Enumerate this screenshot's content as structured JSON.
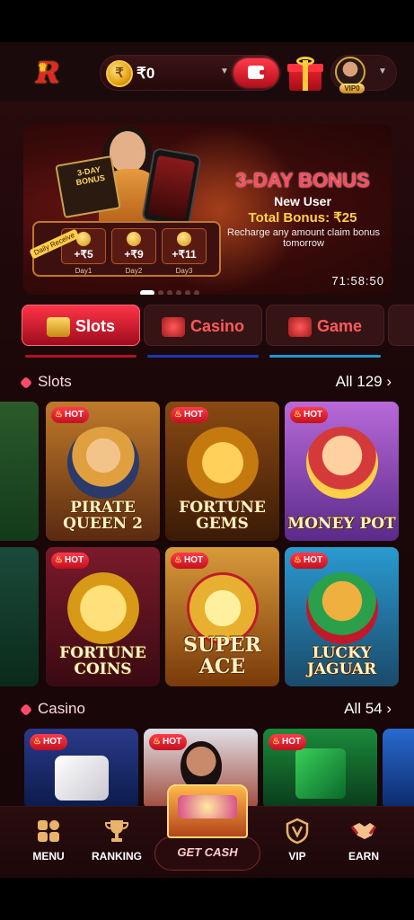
{
  "header": {
    "coin_symbol": "₹",
    "balance": "₹0",
    "vip_badge": "VIP0"
  },
  "banner": {
    "suitcase_text": "3-DAY BONUS",
    "receive_tag": "Daily Receive",
    "days": [
      {
        "amount": "+₹5",
        "label": "Day1"
      },
      {
        "amount": "+₹9",
        "label": "Day2"
      },
      {
        "amount": "+₹11",
        "label": "Day3"
      }
    ],
    "title": "3-DAY BONUS",
    "subtitle": "New User",
    "total": "Total Bonus: ₹25",
    "note": "Recharge any amount claim bonus tomorrow",
    "countdown": "71:58:50"
  },
  "tabs": [
    {
      "label": "Slots",
      "active": true
    },
    {
      "label": "Casino",
      "active": false
    },
    {
      "label": "Game",
      "active": false
    }
  ],
  "slots": {
    "title": "Slots",
    "all": "All 129 ›",
    "games": [
      {
        "name": "PIRATE QUEEN 2",
        "hot": "HOT"
      },
      {
        "name": "FORTUNE GEMS",
        "hot": "HOT"
      },
      {
        "name": "MONEY POT",
        "hot": "HOT"
      },
      {
        "name": "FORTUNE COINS",
        "hot": "HOT"
      },
      {
        "name": "SUPER ACE",
        "hot": "HOT"
      },
      {
        "name": "LUCKY JAGUAR",
        "hot": "HOT"
      }
    ]
  },
  "casino": {
    "title": "Casino",
    "all": "All 54 ›",
    "games": [
      {
        "hot": "HOT"
      },
      {
        "hot": "HOT"
      },
      {
        "hot": "HOT"
      }
    ]
  },
  "nav": {
    "menu": "MENU",
    "ranking": "RANKING",
    "get_cash": "GET CASH",
    "vip": "VIP",
    "earn": "EARN"
  },
  "colors": {
    "accent": "#ff3448",
    "gold": "#ffd24a",
    "background": "#1b0709"
  }
}
